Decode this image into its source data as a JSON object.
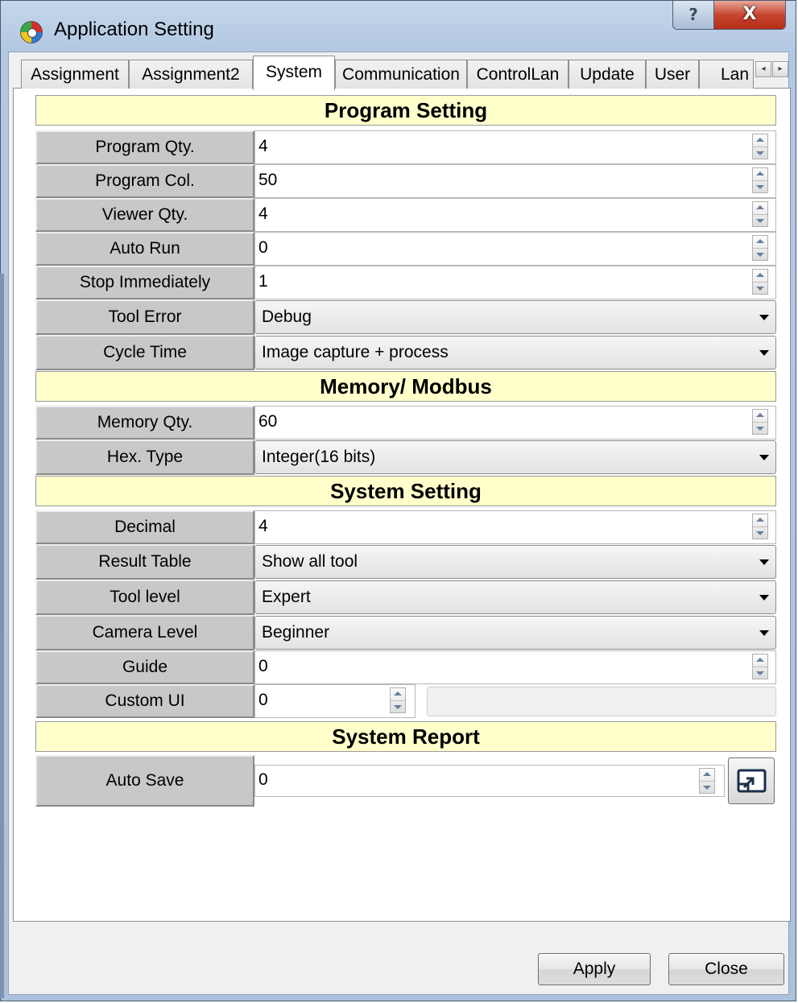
{
  "window": {
    "title": "Application Setting",
    "help_glyph": "?",
    "close_glyph": "X"
  },
  "tabs": {
    "items": [
      "Assignment",
      "Assignment2",
      "System",
      "Communication",
      "ControlLan",
      "Update",
      "User",
      "Lan"
    ],
    "active": "System",
    "scroll_left": "◂",
    "scroll_right": "▸"
  },
  "sections": {
    "program": "Program Setting",
    "memory": "Memory/ Modbus",
    "system": "System Setting",
    "report": "System Report"
  },
  "program": {
    "program_qty": {
      "label": "Program Qty.",
      "value": "4"
    },
    "program_col": {
      "label": "Program Col.",
      "value": "50"
    },
    "viewer_qty": {
      "label": "Viewer Qty.",
      "value": "4"
    },
    "auto_run": {
      "label": "Auto Run",
      "value": "0"
    },
    "stop_immediately": {
      "label": "Stop Immediately",
      "value": "1"
    },
    "tool_error": {
      "label": "Tool Error",
      "value": "Debug"
    },
    "cycle_time": {
      "label": "Cycle Time",
      "value": "Image capture + process"
    }
  },
  "memory": {
    "memory_qty": {
      "label": "Memory Qty.",
      "value": "60"
    },
    "hex_type": {
      "label": "Hex. Type",
      "value": "Integer(16 bits)"
    }
  },
  "system": {
    "decimal": {
      "label": "Decimal",
      "value": "4"
    },
    "result_table": {
      "label": "Result Table",
      "value": "Show all tool"
    },
    "tool_level": {
      "label": "Tool level",
      "value": "Expert"
    },
    "camera_level": {
      "label": "Camera Level",
      "value": "Beginner"
    },
    "guide": {
      "label": "Guide",
      "value": "0"
    },
    "custom_ui": {
      "label": "Custom UI",
      "value": "0"
    }
  },
  "report": {
    "auto_save": {
      "label": "Auto Save",
      "value": "0"
    },
    "browse_icon": "open-window-icon"
  },
  "buttons": {
    "apply": "Apply",
    "close": "Close"
  },
  "colors": {
    "section_bg": "#ffffcc",
    "label_bg": "#c8c8c8",
    "titlebar": "#b3c9e2",
    "close_red": "#c7452f"
  }
}
